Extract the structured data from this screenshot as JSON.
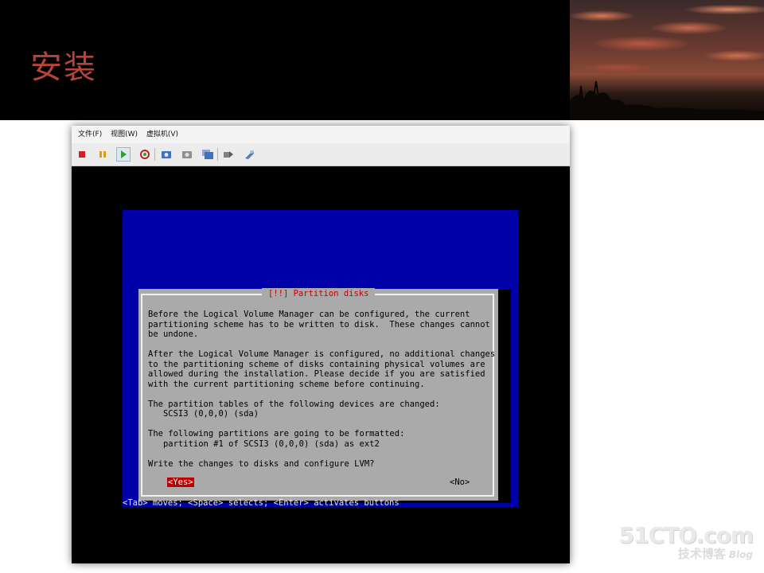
{
  "slide": {
    "title": "安装"
  },
  "vm": {
    "menu": [
      "文件(F)",
      "视图(W)",
      "虚拟机(V)"
    ],
    "toolbar": [
      {
        "name": "stop-icon",
        "color": "#d42020"
      },
      {
        "name": "pause-icon",
        "color": "#e0a000"
      },
      {
        "name": "play-icon",
        "color": "#30a030"
      },
      {
        "name": "reset-icon",
        "color": "#c02020"
      },
      {
        "name": "snapshot-icon",
        "color": "#4070c0"
      },
      {
        "name": "revert-snapshot-icon",
        "color": "#808080"
      },
      {
        "name": "snapshot-manager-icon",
        "color": "#4070c0"
      },
      {
        "name": "send-keys-icon",
        "color": "#707070"
      },
      {
        "name": "settings-icon",
        "color": "#5080b0"
      }
    ]
  },
  "installer": {
    "dialog_title": "[!!] Partition disks",
    "body": "Before the Logical Volume Manager can be configured, the current\npartitioning scheme has to be written to disk.  These changes cannot\nbe undone.\n\nAfter the Logical Volume Manager is configured, no additional changes\nto the partitioning scheme of disks containing physical volumes are\nallowed during the installation. Please decide if you are satisfied\nwith the current partitioning scheme before continuing.\n\nThe partition tables of the following devices are changed:\n   SCSI3 (0,0,0) (sda)\n\nThe following partitions are going to be formatted:\n   partition #1 of SCSI3 (0,0,0) (sda) as ext2\n\nWrite the changes to disks and configure LVM?",
    "yes_label": "<Yes>",
    "no_label": "<No>",
    "hint": "<Tab> moves; <Space> selects; <Enter> activates buttons"
  },
  "watermark": {
    "brand": "51CTO.com",
    "tagline": "技术博客",
    "blog": "Blog"
  }
}
